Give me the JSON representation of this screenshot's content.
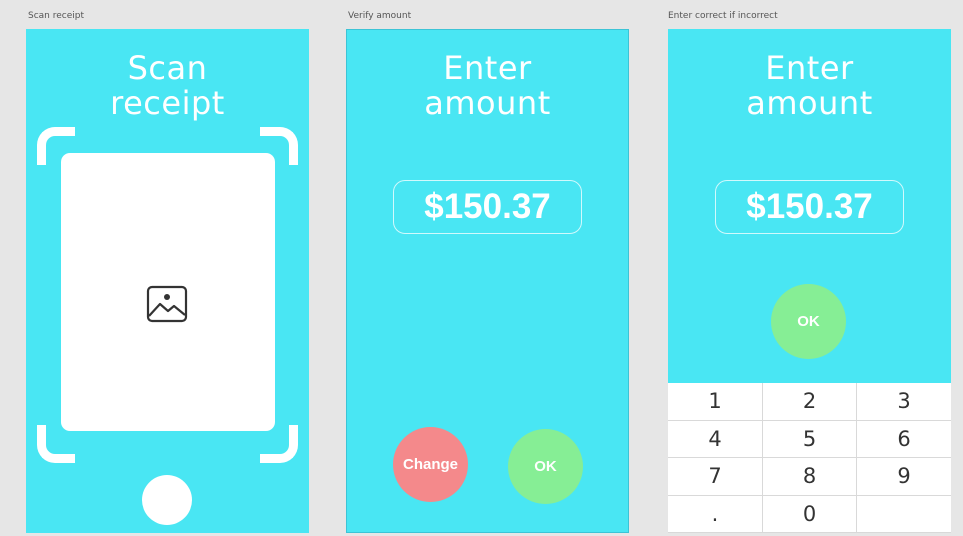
{
  "colors": {
    "screen_bg": "#49e6f3",
    "canvas_bg": "#e6e6e6",
    "change_button": "#f4898b",
    "ok_button": "#86ee95",
    "text_white": "#ffffff"
  },
  "screens": [
    {
      "label": "Scan receipt",
      "title_line1": "Scan",
      "title_line2": "receipt",
      "placeholder_icon": "image-icon"
    },
    {
      "label": "Verify amount",
      "title_line1": "Enter",
      "title_line2": "amount",
      "amount": "$150.37",
      "change_label": "Change",
      "ok_label": "OK"
    },
    {
      "label": "Enter correct if incorrect",
      "title_line1": "Enter",
      "title_line2": "amount",
      "amount": "$150.37",
      "ok_label": "OK",
      "keypad": [
        "1",
        "2",
        "3",
        "4",
        "5",
        "6",
        "7",
        "8",
        "9",
        ".",
        "0",
        ""
      ]
    }
  ]
}
